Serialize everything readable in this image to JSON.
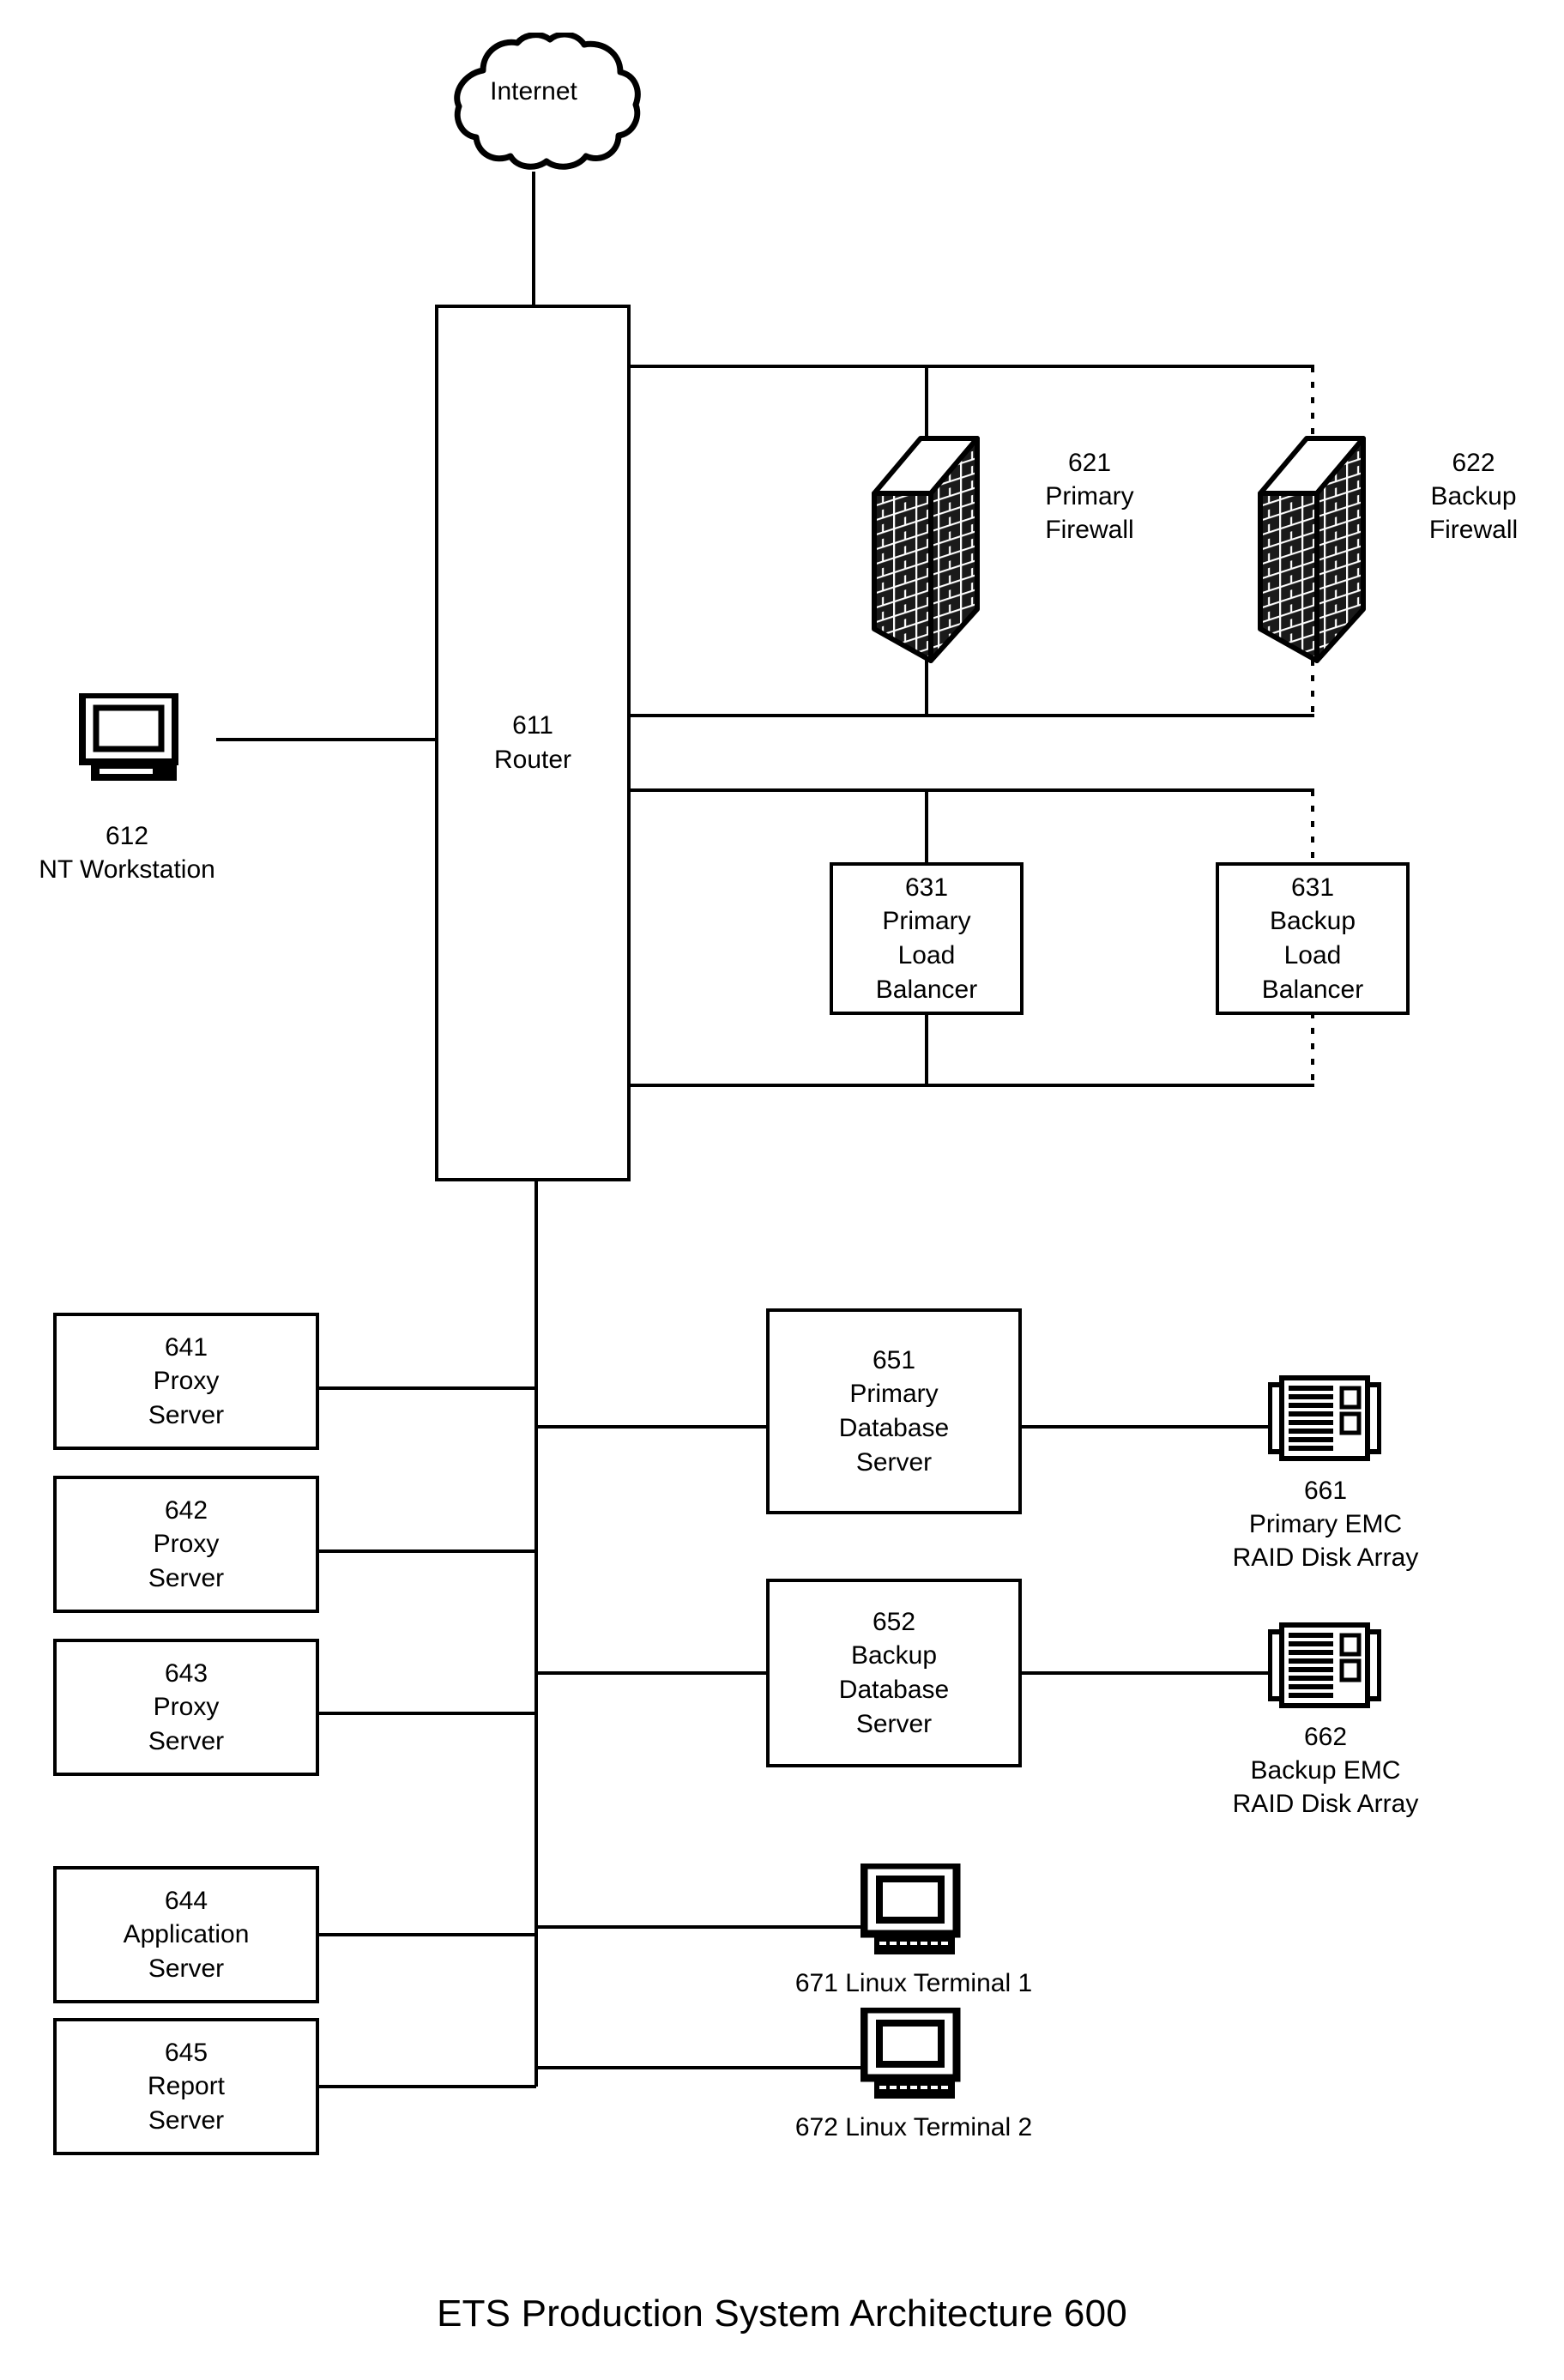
{
  "diagram": {
    "title": "ETS Production System Architecture 600",
    "internet": {
      "label": "Internet",
      "icon": "cloud-icon"
    },
    "router": {
      "id": "611",
      "name": "Router"
    },
    "workstation": {
      "id": "612",
      "name": "NT Workstation",
      "icon": "crt-monitor-icon"
    },
    "firewalls": [
      {
        "id": "621",
        "line1": "Primary",
        "line2": "Firewall",
        "icon": "brick-wall-icon",
        "link": "solid"
      },
      {
        "id": "622",
        "line1": "Backup",
        "line2": "Firewall",
        "icon": "brick-wall-icon",
        "link": "dotted"
      }
    ],
    "load_balancers": [
      {
        "id": "631",
        "line1": "Primary",
        "line2": "Load",
        "line3": "Balancer",
        "link": "solid"
      },
      {
        "id": "631",
        "line1": "Backup",
        "line2": "Load",
        "line3": "Balancer",
        "link": "dotted"
      }
    ],
    "servers": [
      {
        "id": "641",
        "line1": "Proxy",
        "line2": "Server"
      },
      {
        "id": "642",
        "line1": "Proxy",
        "line2": "Server"
      },
      {
        "id": "643",
        "line1": "Proxy",
        "line2": "Server"
      },
      {
        "id": "644",
        "line1": "Application",
        "line2": "Server"
      },
      {
        "id": "645",
        "line1": "Report",
        "line2": "Server"
      }
    ],
    "databases": [
      {
        "id": "651",
        "line1": "Primary",
        "line2": "Database",
        "line3": "Server"
      },
      {
        "id": "652",
        "line1": "Backup",
        "line2": "Database",
        "line3": "Server"
      }
    ],
    "disk_arrays": [
      {
        "id": "661",
        "line1": "Primary EMC",
        "line2": "RAID Disk Array",
        "icon": "raid-disk-array-icon"
      },
      {
        "id": "662",
        "line1": "Backup EMC",
        "line2": "RAID Disk Array",
        "icon": "raid-disk-array-icon"
      }
    ],
    "terminals": [
      {
        "label": "671 Linux Terminal 1",
        "icon": "crt-monitor-icon"
      },
      {
        "label": "672 Linux Terminal 2",
        "icon": "crt-monitor-icon"
      }
    ],
    "colors": {
      "stroke": "#000000",
      "fill": "#ffffff"
    }
  }
}
